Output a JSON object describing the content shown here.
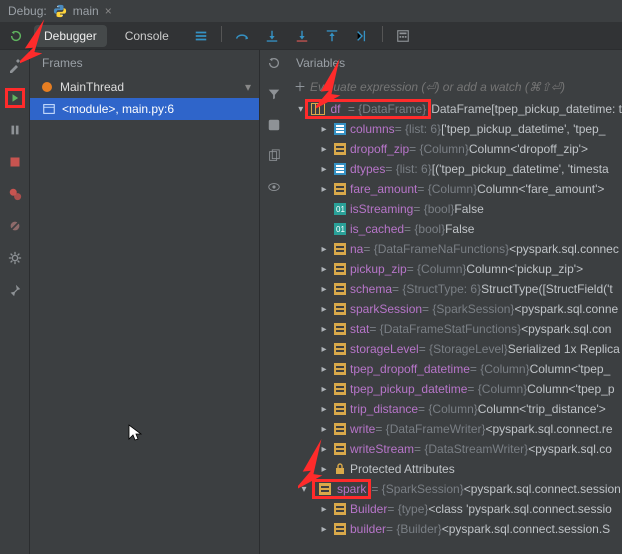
{
  "titlebar": {
    "label": "Debug:",
    "filename": "main"
  },
  "tabs": {
    "debugger": "Debugger",
    "console": "Console"
  },
  "frames": {
    "header": "Frames",
    "thread": "MainThread",
    "frame0": "<module>, main.py:6"
  },
  "vars": {
    "header": "Variables",
    "eval_placeholder": "Evaluate expression (⏎) or add a watch (⌘⇧⏎)"
  },
  "tree": {
    "df": {
      "name": "df",
      "type": "= {DataFrame}",
      "rest": " DataFrame[tpep_pickup_datetime: t"
    },
    "columns": {
      "name": "columns",
      "type": " = {list: 6}",
      "rest": " ['tpep_pickup_datetime', 'tpep_"
    },
    "dropoff_zip": {
      "name": "dropoff_zip",
      "type": " = {Column}",
      "rest": " Column<'dropoff_zip'>"
    },
    "dtypes": {
      "name": "dtypes",
      "type": " = {list: 6}",
      "rest": " [('tpep_pickup_datetime', 'timesta"
    },
    "fare_amount": {
      "name": "fare_amount",
      "type": " = {Column}",
      "rest": " Column<'fare_amount'>"
    },
    "isStreaming": {
      "name": "isStreaming",
      "type": " = {bool}",
      "rest": " False"
    },
    "is_cached": {
      "name": "is_cached",
      "type": " = {bool}",
      "rest": " False"
    },
    "na": {
      "name": "na",
      "type": " = {DataFrameNaFunctions}",
      "rest": " <pyspark.sql.connec"
    },
    "pickup_zip": {
      "name": "pickup_zip",
      "type": " = {Column}",
      "rest": " Column<'pickup_zip'>"
    },
    "schema": {
      "name": "schema",
      "type": " = {StructType: 6}",
      "rest": " StructType([StructField('t"
    },
    "sparkSession": {
      "name": "sparkSession",
      "type": " = {SparkSession}",
      "rest": " <pyspark.sql.conne"
    },
    "stat": {
      "name": "stat",
      "type": " = {DataFrameStatFunctions}",
      "rest": " <pyspark.sql.con"
    },
    "storageLevel": {
      "name": "storageLevel",
      "type": " = {StorageLevel}",
      "rest": " Serialized 1x Replica"
    },
    "tpep_dropoff_datetime": {
      "name": "tpep_dropoff_datetime",
      "type": " = {Column}",
      "rest": " Column<'tpep_"
    },
    "tpep_pickup_datetime": {
      "name": "tpep_pickup_datetime",
      "type": " = {Column}",
      "rest": " Column<'tpep_p"
    },
    "trip_distance": {
      "name": "trip_distance",
      "type": " = {Column}",
      "rest": " Column<'trip_distance'>"
    },
    "write": {
      "name": "write",
      "type": " = {DataFrameWriter}",
      "rest": " <pyspark.sql.connect.re"
    },
    "writeStream": {
      "name": "writeStream",
      "type": " = {DataStreamWriter}",
      "rest": " <pyspark.sql.co"
    },
    "protected": {
      "name": "Protected Attributes"
    },
    "spark": {
      "name": "spark",
      "type": " = {SparkSession}",
      "rest": " <pyspark.sql.connect.session"
    },
    "Builder": {
      "name": "Builder",
      "type": " = {type}",
      "rest": " <class 'pyspark.sql.connect.sessio"
    },
    "builder": {
      "name": "builder",
      "type": " = {Builder}",
      "rest": " <pyspark.sql.connect.session.S"
    }
  }
}
